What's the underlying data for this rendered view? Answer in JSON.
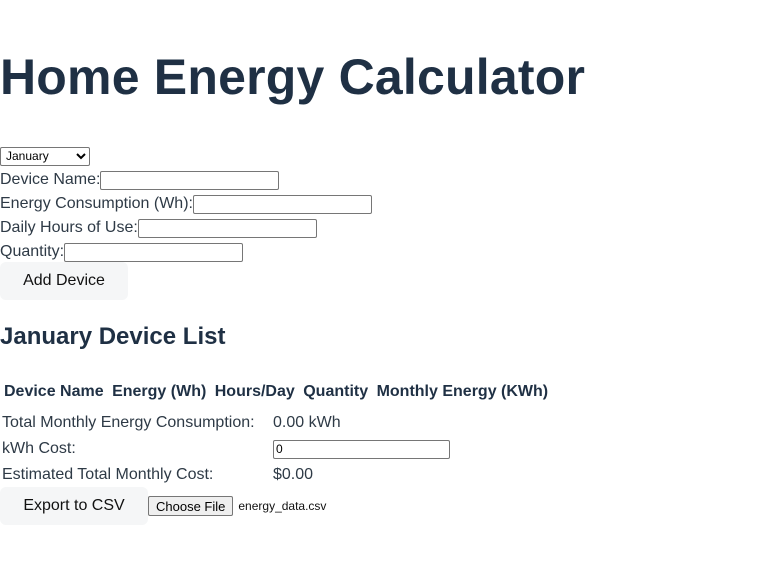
{
  "page_title": "Home Energy Calculator",
  "month_select": {
    "selected": "January"
  },
  "form": {
    "device_name_label": "Device Name:",
    "device_name_value": "",
    "energy_label": "Energy Consumption (Wh):",
    "energy_value": "",
    "hours_label": "Daily Hours of Use:",
    "hours_value": "",
    "quantity_label": "Quantity:",
    "quantity_value": "",
    "add_button": "Add Device"
  },
  "device_list": {
    "heading": "January Device List",
    "columns": [
      "Device Name",
      "Energy (Wh)",
      "Hours/Day",
      "Quantity",
      "Monthly Energy (KWh)"
    ],
    "rows": []
  },
  "summary": {
    "total_label": "Total Monthly Energy Consumption:",
    "total_value": "0.00 kWh",
    "cost_label": "kWh Cost:",
    "cost_value": "0",
    "estimated_label": "Estimated Total Monthly Cost:",
    "estimated_value": "$0.00"
  },
  "actions": {
    "export_button": "Export to CSV",
    "choose_file_button": "Choose File",
    "file_name": "energy_data.csv"
  }
}
